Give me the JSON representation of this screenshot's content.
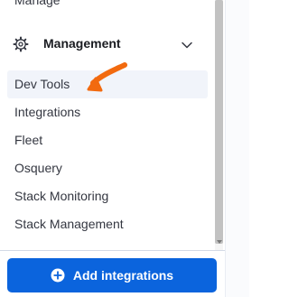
{
  "nav": {
    "previous_item_label": "Manage",
    "section": {
      "title": "Management",
      "icon": "gear-icon",
      "toggle_icon": "chevron-down-icon",
      "expanded": true
    },
    "items": [
      {
        "label": "Dev Tools",
        "active": true
      },
      {
        "label": "Integrations",
        "active": false
      },
      {
        "label": "Fleet",
        "active": false
      },
      {
        "label": "Osquery",
        "active": false
      },
      {
        "label": "Stack Monitoring",
        "active": false
      },
      {
        "label": "Stack Management",
        "active": false
      }
    ]
  },
  "footer": {
    "add_button_label": "Add integrations",
    "add_button_icon": "plus-circle-icon"
  },
  "colors": {
    "primary": "#0b64dd",
    "active_item_bg": "#f1f4fa",
    "annotation": "#f26a0f",
    "text": "#343741"
  }
}
